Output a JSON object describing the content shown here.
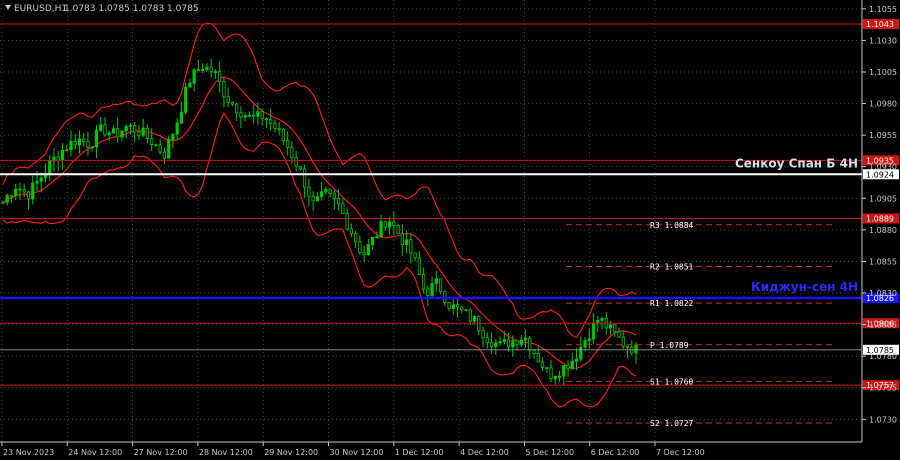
{
  "header": {
    "symbol_label": "EURUSD,H1",
    "ohlc": "1.0783 1.0785 1.0783 1.0785"
  },
  "colors": {
    "background": "#000000",
    "grid": "#5a5a5a",
    "candle_up": "#00c800",
    "candle_down": "#00c800",
    "bollinger": "#ff1e1e",
    "level_red": "#d01414",
    "senkou": "#ffffff",
    "kijun": "#1414ff",
    "pivot_dash": "#c03030",
    "pivot_text": "#ffffff",
    "price_line": "#9a9a9a",
    "axis_text": "#c8c8c8"
  },
  "chart_data": {
    "type": "candlestick",
    "title": "",
    "xlabel": "",
    "ylabel": "",
    "ylim": [
      1.0712,
      1.1062
    ],
    "y_ticks": [
      "1.1055",
      "1.1030",
      "1.1005",
      "1.0980",
      "1.0955",
      "1.0930",
      "1.0905",
      "1.0880",
      "1.0855",
      "1.0830",
      "1.0805",
      "1.0780",
      "1.0755",
      "1.0730"
    ],
    "x_ticks": [
      "23 Nov 2023",
      "24 Nov 12:00",
      "27 Nov 12:00",
      "28 Nov 12:00",
      "29 Nov 12:00",
      "30 Nov 12:00",
      "1 Dec 12:00",
      "4 Dec 12:00",
      "5 Dec 12:00",
      "6 Dec 12:00",
      "7 Dec 12:00"
    ],
    "series_close": [
      1.0902,
      1.0915,
      1.0908,
      1.0921,
      1.0935,
      1.0945,
      1.0952,
      1.0948,
      1.096,
      1.0955,
      1.0962,
      1.0958,
      1.095,
      1.094,
      1.0965,
      1.0998,
      1.101,
      1.1005,
      1.0985,
      1.0975,
      1.0968,
      1.097,
      1.096,
      1.0945,
      1.0925,
      1.09,
      1.0908,
      1.09,
      1.088,
      1.086,
      1.0875,
      1.089,
      1.0875,
      1.086,
      1.083,
      1.0838,
      1.082,
      1.0815,
      1.0808,
      1.0795,
      1.0788,
      1.0792,
      1.0796,
      1.078,
      1.0765,
      1.077,
      1.0778,
      1.0795,
      1.081,
      1.08,
      1.079,
      1.0785
    ],
    "levels": [
      {
        "type": "resistance",
        "value": 1.1043,
        "label": "1.1043"
      },
      {
        "type": "resistance",
        "value": 1.0935,
        "label": "1.0935"
      },
      {
        "type": "senkou_span_b",
        "value": 1.0924,
        "label": "1.0924",
        "caption": "Сенкоу Спан Б 4Н"
      },
      {
        "type": "resistance",
        "value": 1.0889,
        "label": "1.0889"
      },
      {
        "type": "kijun_sen",
        "value": 1.0826,
        "label": "1.0826",
        "caption": "Киджун-сен 4Н"
      },
      {
        "type": "resistance",
        "value": 1.0806,
        "label": "1.0806"
      },
      {
        "type": "current_price",
        "value": 1.0785,
        "label": "1.0785"
      },
      {
        "type": "support",
        "value": 1.0757,
        "label": "1.0757"
      }
    ],
    "pivots": [
      {
        "name": "R3",
        "value": 1.0884,
        "label": "R3 1.0884"
      },
      {
        "name": "R2",
        "value": 1.0851,
        "label": "R2 1.0851"
      },
      {
        "name": "R1",
        "value": 1.0822,
        "label": "R1 1.0822"
      },
      {
        "name": "P",
        "value": 1.0789,
        "label": "P 1.0789"
      },
      {
        "name": "S1",
        "value": 1.076,
        "label": "S1 1.0760"
      },
      {
        "name": "S2",
        "value": 1.0727,
        "label": "S2 1.0727"
      }
    ],
    "grid": true
  }
}
